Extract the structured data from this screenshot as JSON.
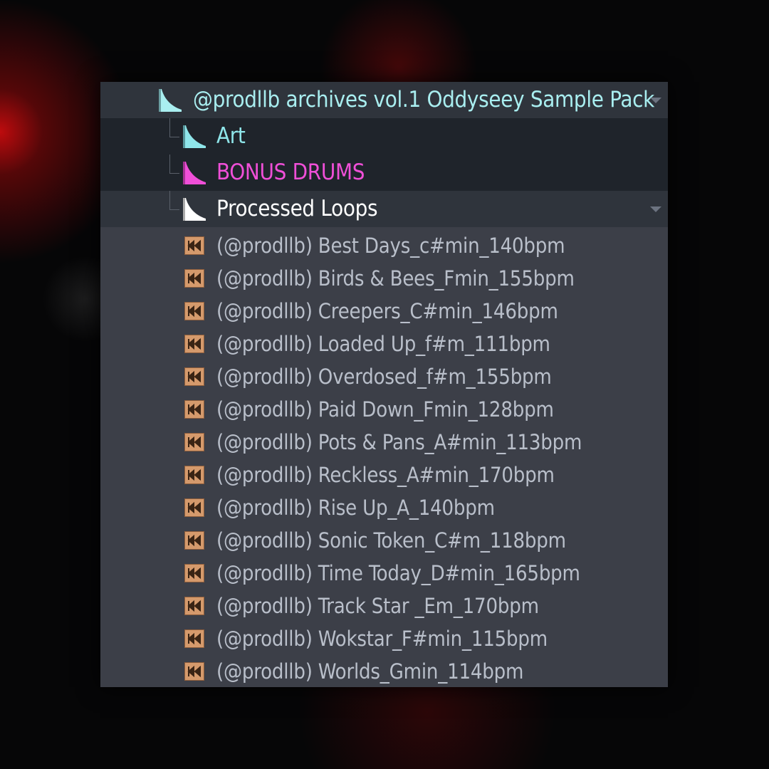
{
  "browser": {
    "root_folder": {
      "label": "@prodllb archives vol.1 Oddyseey Sample Pack",
      "color": "#a9eef0"
    },
    "folders": [
      {
        "label": "Art",
        "color": "#8fe6ea"
      },
      {
        "label": "BONUS DRUMS",
        "color": "#f04fd8"
      },
      {
        "label": "Processed Loops",
        "color": "#ffffff"
      }
    ],
    "files": [
      {
        "label": "(@prodllb) Best Days_c#min_140bpm"
      },
      {
        "label": "(@prodllb) Birds & Bees_Fmin_155bpm"
      },
      {
        "label": "(@prodllb) Creepers_C#min_146bpm"
      },
      {
        "label": "(@prodllb) Loaded Up_f#m_111bpm"
      },
      {
        "label": "(@prodllb) Overdosed_f#m_155bpm"
      },
      {
        "label": "(@prodllb) Paid Down_Fmin_128bpm"
      },
      {
        "label": "(@prodllb) Pots & Pans_A#min_113bpm"
      },
      {
        "label": "(@prodllb) Reckless_A#min_170bpm"
      },
      {
        "label": "(@prodllb) Rise Up_A_140bpm"
      },
      {
        "label": "(@prodllb) Sonic Token_C#m_118bpm"
      },
      {
        "label": "(@prodllb) Time Today_D#min_165bpm"
      },
      {
        "label": "(@prodllb) Track Star _Em_170bpm"
      },
      {
        "label": "(@prodllb) Wokstar_F#min_115bpm"
      },
      {
        "label": "(@prodllb) Worlds_Gmin_114bpm"
      }
    ],
    "icons": {
      "folder": "folder-wedge-icon",
      "audio_file": "audio-file-icon",
      "expand": "chevron-down-icon"
    },
    "colors": {
      "file_icon": "#d59a6c",
      "file_text": "#b9bfca",
      "panel": "#3c3f48"
    }
  }
}
